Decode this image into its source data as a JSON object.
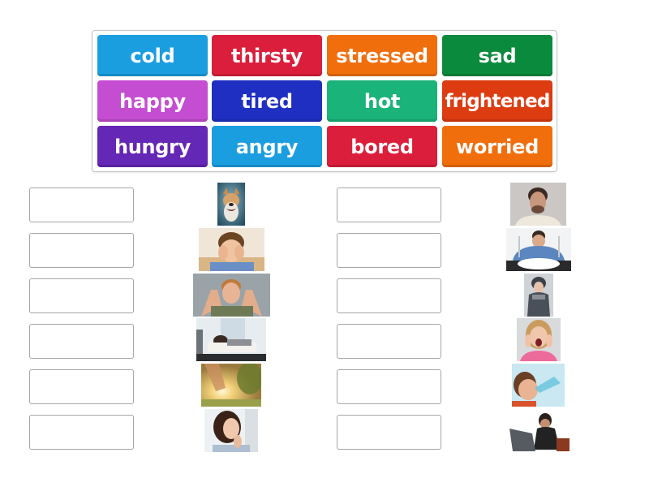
{
  "word_bank": {
    "tiles": [
      {
        "label": "cold",
        "color": "#1a9ee0"
      },
      {
        "label": "thirsty",
        "color": "#db1e3c"
      },
      {
        "label": "stressed",
        "color": "#f06e0c"
      },
      {
        "label": "sad",
        "color": "#0a8a3c"
      },
      {
        "label": "happy",
        "color": "#c44dd1"
      },
      {
        "label": "tired",
        "color": "#1f2fc2"
      },
      {
        "label": "hot",
        "color": "#1ab37a"
      },
      {
        "label": "frightened",
        "color": "#dd3b10"
      },
      {
        "label": "hungry",
        "color": "#6527b5"
      },
      {
        "label": "angry",
        "color": "#1a9ee0"
      },
      {
        "label": "bored",
        "color": "#db1e3c"
      },
      {
        "label": "worried",
        "color": "#f06e0c"
      }
    ]
  },
  "matches": {
    "left": [
      {
        "answer": "",
        "image": "laughing-dog-image"
      },
      {
        "answer": "",
        "image": "bored-boy-image"
      },
      {
        "answer": "",
        "image": "stressed-man-image"
      },
      {
        "answer": "",
        "image": "tired-man-desk-image"
      },
      {
        "answer": "",
        "image": "hot-sun-image"
      },
      {
        "answer": "",
        "image": "worried-woman-image"
      }
    ],
    "right": [
      {
        "answer": "",
        "image": "sad-man-image"
      },
      {
        "answer": "",
        "image": "hungry-man-plate-image"
      },
      {
        "answer": "",
        "image": "cold-woman-image"
      },
      {
        "answer": "",
        "image": "frightened-girl-image"
      },
      {
        "answer": "",
        "image": "thirsty-boy-drinking-image"
      },
      {
        "answer": "",
        "image": "angry-person-laptop-image"
      }
    ]
  }
}
